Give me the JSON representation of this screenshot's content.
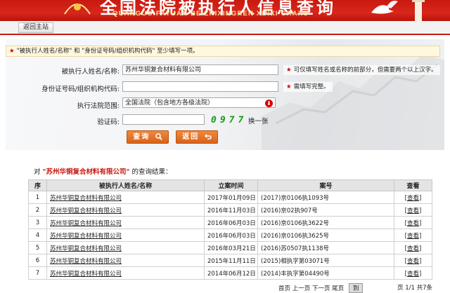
{
  "header": {
    "title": "全国法院被执行人信息查询",
    "subtitle": "QUANGUO FAYUAN BEIZHIXINGREN XINXI CHAXU"
  },
  "nav": {
    "home_label": "返回主站"
  },
  "notice": {
    "text": "\"被执行人姓名/名称\" 和 \"身份证号码/组织机构代码\" 至少填写一项。"
  },
  "form": {
    "name_label": "被执行人姓名/名称:",
    "name_value": "苏州华铜复合材料有限公司",
    "name_hint": "可仅填写姓名或名称的前部分，但需要两个以上汉字。",
    "id_label": "身份证号码/组织机构代码:",
    "id_value": "",
    "id_hint": "需填写完整。",
    "court_label": "执行法院范围:",
    "court_value": "全国法院（包含地方各级法院）",
    "captcha_label": "验证码:",
    "captcha_value": "",
    "captcha_image_text": "0977",
    "refresh_label": "换一张",
    "search_button": "查询",
    "back_button": "返回"
  },
  "results": {
    "prefix": "对",
    "query": "\"苏州华铜复合材料有限公司\"",
    "suffix": "的查询结果：",
    "columns": [
      "序",
      "被执行人姓名/名称",
      "立案时间",
      "案号",
      "查看"
    ],
    "rows": [
      {
        "no": "1",
        "name": "苏州华铜复合材料有限公司",
        "date": "2017年01月09日",
        "case": "(2017)京0106执1093号",
        "view": "[查看]"
      },
      {
        "no": "2",
        "name": "苏州华铜复合材料有限公司",
        "date": "2016年11月03日",
        "case": "(2016)京02执907号",
        "view": "[查看]"
      },
      {
        "no": "3",
        "name": "苏州华铜复合材料有限公司",
        "date": "2016年06月03日",
        "case": "(2016)京0106执3622号",
        "view": "[查看]"
      },
      {
        "no": "4",
        "name": "苏州华铜复合材料有限公司",
        "date": "2016年06月03日",
        "case": "(2016)京0106执3625号",
        "view": "[查看]"
      },
      {
        "no": "5",
        "name": "苏州华铜复合材料有限公司",
        "date": "2016年03月21日",
        "case": "(2016)苏0507执1138号",
        "view": "[查看]"
      },
      {
        "no": "6",
        "name": "苏州华铜复合材料有限公司",
        "date": "2015年11月11日",
        "case": "(2015)相执字第03071号",
        "view": "[查看]"
      },
      {
        "no": "7",
        "name": "苏州华铜复合材料有限公司",
        "date": "2014年06月12日",
        "case": "(2014)丰执字第04490号",
        "view": "[查看]"
      }
    ]
  },
  "pager": {
    "first": "首页",
    "prev": "上一页",
    "next": "下一页",
    "last": "尾页",
    "go": "到",
    "info": "页 1/1 共7条"
  },
  "colors": {
    "banner": "#c81a10",
    "accent_button": "#e0722a",
    "required_star": "#d60000",
    "captcha": "#1a9a1a"
  },
  "icons": [
    "emblem-icon",
    "dove-icon",
    "pillar-icon",
    "warning-arrow-icon",
    "magnifier-icon",
    "return-arrow-icon"
  ]
}
